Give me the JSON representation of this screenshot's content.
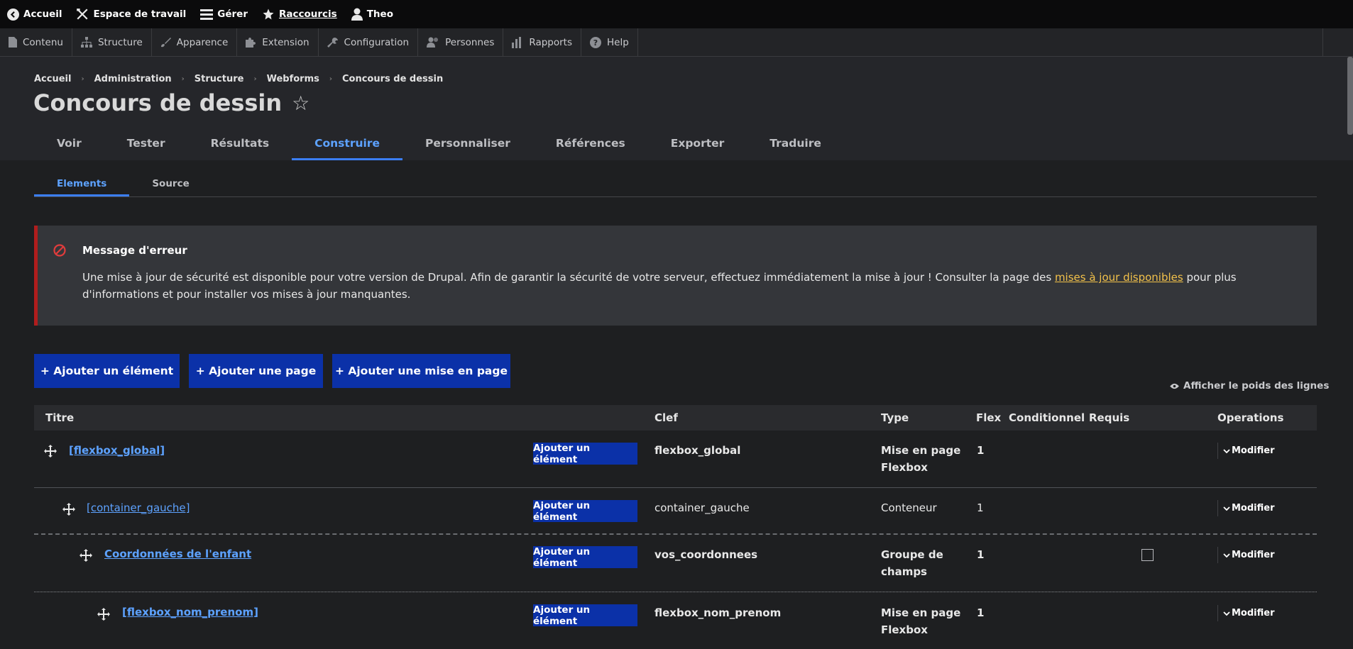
{
  "topbar": {
    "items": [
      {
        "label": "Accueil",
        "icon": "back-circle-icon"
      },
      {
        "label": "Espace de travail",
        "icon": "tools-icon"
      },
      {
        "label": "Gérer",
        "icon": "hamburger-icon"
      },
      {
        "label": "Raccourcis",
        "icon": "star-icon"
      },
      {
        "label": "Theo",
        "icon": "user-icon"
      }
    ]
  },
  "admin_menu": {
    "items": [
      {
        "label": "Contenu",
        "icon": "document-icon"
      },
      {
        "label": "Structure",
        "icon": "hierarchy-icon"
      },
      {
        "label": "Apparence",
        "icon": "brush-icon"
      },
      {
        "label": "Extension",
        "icon": "puzzle-icon"
      },
      {
        "label": "Configuration",
        "icon": "wrench-icon"
      },
      {
        "label": "Personnes",
        "icon": "people-icon"
      },
      {
        "label": "Rapports",
        "icon": "bar-chart-icon"
      },
      {
        "label": "Help",
        "icon": "help-icon"
      }
    ]
  },
  "breadcrumb": [
    "Accueil",
    "Administration",
    "Structure",
    "Webforms",
    "Concours de dessin"
  ],
  "page": {
    "title": "Concours de dessin",
    "star": "☆"
  },
  "main_tabs": [
    "Voir",
    "Tester",
    "Résultats",
    "Construire",
    "Personnaliser",
    "Références",
    "Exporter",
    "Traduire"
  ],
  "sub_tabs": [
    "Elements",
    "Source"
  ],
  "alert": {
    "title": "Message d'erreur",
    "text_before": "Une mise à jour de sécurité est disponible pour votre version de Drupal. Afin de garantir la sécurité de votre serveur, effectuez immédiatement la mise à jour ! Consulter la page des ",
    "link": "mises à jour disponibles",
    "text_after": " pour plus d'informations et pour installer vos mises à jour manquantes."
  },
  "actions": {
    "add_element": "+ Ajouter un élément",
    "add_page": "+ Ajouter une page",
    "add_layout": "+ Ajouter une mise en page",
    "show_weights": "Afficher le poids des lignes"
  },
  "table": {
    "headers": {
      "title": "Titre",
      "key": "Clef",
      "type": "Type",
      "flex": "Flex",
      "conditional": "Conditionnel",
      "required": "Requis",
      "operations": "Operations"
    },
    "add_button": "Ajouter un élément",
    "modify": "Modifier",
    "rows": [
      {
        "title": "[flexbox_global]",
        "key": "flexbox_global",
        "type_line1": "Mise en page",
        "type_line2": "Flexbox",
        "flex": "1"
      },
      {
        "title": "[container_gauche]",
        "key": "container_gauche",
        "type_line1": "Conteneur",
        "type_line2": "",
        "flex": "1"
      },
      {
        "title": "Coordonnées de l'enfant",
        "key": "vos_coordonnees",
        "type_line1": "Groupe de",
        "type_line2": "champs",
        "flex": "1"
      },
      {
        "title": "[flexbox_nom_prenom]",
        "key": "flexbox_nom_prenom",
        "type_line1": "Mise en page",
        "type_line2": "Flexbox",
        "flex": "1"
      }
    ]
  },
  "colors": {
    "accent": "#3b7ef5",
    "button": "#0b31a8",
    "error": "#b01d1d",
    "link_warning": "#f2c14a"
  }
}
